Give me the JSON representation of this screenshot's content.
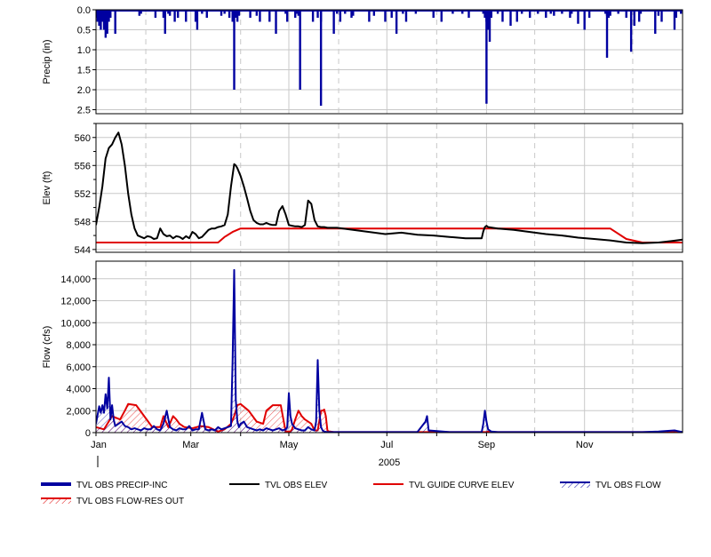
{
  "chart_data": {
    "type": "line",
    "x_axis": {
      "ticks": [
        "Jan",
        "Mar",
        "May",
        "Jul",
        "Sep",
        "Nov"
      ],
      "year_label": "2005",
      "domain_days": [
        0,
        365
      ]
    },
    "panels": [
      {
        "ylabel": "Precip (in)",
        "yticks": [
          "0.0",
          "0.5",
          "1.0",
          "1.5",
          "2.0",
          "2.5"
        ],
        "ylim": [
          2.6,
          0
        ],
        "inverted": true,
        "series": [
          {
            "name": "TVL OBS PRECIP-INC",
            "type": "bar",
            "color": "#0000a0",
            "x": [
              0,
              1,
              2,
              3,
              4,
              5,
              6,
              7,
              8,
              9,
              12,
              27,
              28,
              37,
              42,
              43,
              45,
              46,
              49,
              51,
              56,
              62,
              63,
              66,
              69,
              78,
              80,
              83,
              85,
              86,
              87,
              88,
              89,
              96,
              100,
              102,
              108,
              112,
              118,
              119,
              124,
              125,
              126,
              127,
              135,
              138,
              140,
              148,
              150,
              152,
              155,
              159,
              160,
              170,
              173,
              180,
              184,
              187,
              191,
              193,
              199,
              210,
              215,
              222,
              228,
              232,
              241,
              242,
              243,
              244,
              245,
              246,
              250,
              253,
              258,
              262,
              265,
              270,
              275,
              280,
              283,
              285,
              290,
              295,
              296,
              300,
              304,
              307,
              317,
              318,
              319,
              320,
              325,
              330,
              335,
              338,
              339,
              348,
              350,
              352,
              360,
              361,
              364
            ],
            "values": [
              0.2,
              0.3,
              0.4,
              0.5,
              0.3,
              0.5,
              0.7,
              0.6,
              0.3,
              0.2,
              0.6,
              0.15,
              0.1,
              0.2,
              0.2,
              0.6,
              0.1,
              0.15,
              0.3,
              0.2,
              0.3,
              0.3,
              0.5,
              0.1,
              0.2,
              0.15,
              0.1,
              0.2,
              0.3,
              0.15,
              0.2,
              0.3,
              0.15,
              0.2,
              0.15,
              0.3,
              0.3,
              0.6,
              0.1,
              0.3,
              0.2,
              0.1,
              0.15,
              2.0,
              0.3,
              0.2,
              0.3,
              0.6,
              0.1,
              0.3,
              0.1,
              0.2,
              0.15,
              0.3,
              0.15,
              0.3,
              0.2,
              0.6,
              0.1,
              0.3,
              0.1,
              0.2,
              0.3,
              0.1,
              0.1,
              0.2,
              0.1,
              0.2,
              0.3,
              0.5,
              0.8,
              0.2,
              0.1,
              0.3,
              0.4,
              0.3,
              0.1,
              0.2,
              0.1,
              0.2,
              0.1,
              0.15,
              0.1,
              0.2,
              0.1,
              0.35,
              0.5,
              0.2,
              0.1,
              0.15,
              0.2,
              0.15,
              0.1,
              0.2,
              0.4,
              0.3,
              0.1,
              0.6,
              0.15,
              0.3,
              0.5,
              0.2,
              0.1
            ],
            "extra_points": [
              [
                86,
                2.0
              ],
              [
                140,
                2.4
              ],
              [
                243,
                2.35
              ],
              [
                318,
                1.2
              ],
              [
                333,
                1.05
              ]
            ]
          }
        ]
      },
      {
        "ylabel": "Elev (ft)",
        "yticks": [
          "544",
          "548",
          "552",
          "556",
          "560"
        ],
        "ylim": [
          543.6,
          562
        ],
        "series": [
          {
            "name": "TVL OBS ELEV",
            "type": "line",
            "color": "#000000",
            "x": [
              0,
              2,
              4,
              6,
              8,
              10,
              12,
              14,
              16,
              18,
              20,
              22,
              24,
              26,
              28,
              30,
              32,
              34,
              36,
              38,
              40,
              42,
              44,
              46,
              48,
              50,
              52,
              54,
              56,
              58,
              60,
              62,
              64,
              66,
              68,
              70,
              72,
              74,
              76,
              78,
              80,
              82,
              84,
              86,
              87,
              88,
              90,
              92,
              94,
              96,
              98,
              100,
              102,
              104,
              106,
              108,
              110,
              112,
              114,
              116,
              118,
              120,
              122,
              124,
              126,
              128,
              130,
              132,
              134,
              136,
              138,
              140,
              142,
              144,
              146,
              148,
              150,
              160,
              170,
              180,
              190,
              200,
              210,
              220,
              230,
              240,
              241,
              242,
              243,
              244,
              250,
              260,
              270,
              280,
              290,
              300,
              310,
              320,
              330,
              340,
              350,
              358,
              365
            ],
            "values": [
              547.5,
              550,
              553,
              557,
              558.5,
              559,
              560,
              560.7,
              559,
              556,
              552,
              549,
              547,
              546,
              545.8,
              545.6,
              545.9,
              545.8,
              545.5,
              545.6,
              547,
              546.2,
              545.9,
              546,
              545.6,
              545.9,
              545.8,
              545.5,
              545.9,
              545.6,
              546.5,
              546.2,
              545.6,
              545.8,
              546.3,
              546.8,
              547,
              547,
              547.2,
              547.3,
              547.5,
              549,
              553,
              556.2,
              556,
              555.6,
              554.5,
              553,
              551.3,
              549.5,
              548.2,
              547.8,
              547.6,
              547.6,
              547.8,
              547.6,
              547.5,
              547.5,
              549.5,
              550.2,
              549,
              547.5,
              547.4,
              547.3,
              547.3,
              547.2,
              547.5,
              551,
              550.5,
              548.2,
              547.3,
              547.2,
              547.2,
              547.1,
              547.1,
              547.1,
              547.1,
              546.8,
              546.5,
              546.2,
              546.4,
              546.1,
              546,
              545.8,
              545.6,
              545.6,
              546.6,
              547.2,
              547.4,
              547.2,
              547,
              546.8,
              546.5,
              546.2,
              546,
              545.7,
              545.5,
              545.3,
              545,
              544.9,
              545,
              545.2,
              545.4
            ]
          },
          {
            "name": "TVL GUIDE CURVE ELEV",
            "type": "line",
            "color": "#e00000",
            "x": [
              0,
              76,
              80,
              85,
              90,
              110,
              130,
              150,
              170,
              250,
              290,
              310,
              320,
              330,
              340,
              365
            ],
            "values": [
              545,
              545,
              545.8,
              546.5,
              547,
              547,
              547,
              547,
              547,
              547,
              547,
              547,
              547,
              545.5,
              545,
              545
            ]
          }
        ]
      },
      {
        "ylabel": "Flow (cfs)",
        "yticks": [
          "0",
          "2,000",
          "4,000",
          "6,000",
          "8,000",
          "10,000",
          "12,000",
          "14,000"
        ],
        "ylim": [
          0,
          15600
        ],
        "series": [
          {
            "name": "TVL OBS FLOW",
            "type": "area",
            "color": "#0000a0",
            "x": [
              0,
              1,
              2,
              3,
              4,
              5,
              6,
              7,
              8,
              9,
              10,
              11,
              12,
              14,
              16,
              18,
              20,
              22,
              24,
              26,
              28,
              30,
              32,
              34,
              36,
              38,
              40,
              42,
              44,
              46,
              48,
              50,
              52,
              54,
              56,
              58,
              60,
              62,
              64,
              66,
              68,
              70,
              72,
              74,
              76,
              78,
              80,
              82,
              84,
              85,
              86,
              87,
              88,
              89,
              90,
              92,
              94,
              96,
              98,
              100,
              102,
              104,
              106,
              108,
              110,
              112,
              114,
              116,
              118,
              119,
              120,
              121,
              122,
              124,
              126,
              128,
              130,
              132,
              134,
              136,
              137,
              138,
              139,
              140,
              141,
              142,
              144,
              146,
              150,
              160,
              170,
              180,
              200,
              205,
              206,
              207,
              220,
              240,
              241,
              242,
              243,
              244,
              246,
              250,
              260,
              280,
              300,
              320,
              340,
              350,
              360,
              365
            ],
            "values": [
              800,
              1600,
              2400,
              1800,
              2500,
              1800,
              3500,
              2200,
              5000,
              1200,
              2500,
              1200,
              600,
              800,
              1000,
              600,
              500,
              300,
              400,
              300,
              200,
              400,
              300,
              300,
              600,
              300,
              200,
              800,
              2000,
              500,
              300,
              200,
              400,
              300,
              300,
              600,
              200,
              300,
              300,
              1800,
              300,
              200,
              300,
              200,
              500,
              300,
              400,
              500,
              600,
              6500,
              14800,
              3000,
              1000,
              500,
              800,
              1000,
              500,
              400,
              300,
              200,
              300,
              200,
              400,
              300,
              200,
              300,
              400,
              200,
              300,
              500,
              3600,
              1500,
              800,
              400,
              300,
              200,
              200,
              500,
              300,
              200,
              1000,
              6600,
              2000,
              500,
              200,
              100,
              50,
              50,
              50,
              50,
              50,
              50,
              50,
              1000,
              1500,
              200,
              50,
              50,
              800,
              2000,
              1000,
              300,
              100,
              50,
              50,
              50,
              50,
              50,
              50,
              100,
              200,
              50
            ]
          },
          {
            "name": "TVL OBS FLOW-RES OUT",
            "type": "area",
            "color": "#e00000",
            "x": [
              0,
              5,
              10,
              15,
              18,
              20,
              25,
              30,
              35,
              40,
              42,
              45,
              48,
              50,
              52,
              55,
              60,
              65,
              70,
              76,
              80,
              84,
              86,
              88,
              90,
              95,
              100,
              104,
              106,
              110,
              115,
              118,
              120,
              121,
              122,
              124,
              126,
              128,
              130,
              132,
              134,
              136,
              138,
              140,
              141,
              142,
              143,
              144,
              145,
              146,
              148,
              150,
              160,
              180,
              200,
              220,
              240,
              243,
              244,
              246,
              250,
              260,
              280,
              300,
              320,
              340,
              350,
              360,
              365
            ],
            "values": [
              500,
              300,
              1500,
              1200,
              2000,
              2600,
              2500,
              1500,
              500,
              500,
              1500,
              500,
              1500,
              1200,
              800,
              500,
              400,
              600,
              500,
              100,
              300,
              800,
              1500,
              2500,
              2600,
              2000,
              1000,
              800,
              2000,
              2500,
              2500,
              100,
              100,
              100,
              300,
              1200,
              2000,
              1500,
              1200,
              1000,
              800,
              200,
              200,
              2000,
              2000,
              2100,
              1500,
              200,
              100,
              100,
              50,
              50,
              50,
              50,
              50,
              50,
              50,
              50,
              100,
              50,
              50,
              50,
              50,
              50,
              50,
              50,
              50,
              50,
              50
            ]
          }
        ]
      }
    ],
    "legend": [
      {
        "label": "TVL OBS PRECIP-INC",
        "style": "thick",
        "color": "#0000a0"
      },
      {
        "label": "TVL OBS ELEV",
        "style": "line",
        "color": "#000000"
      },
      {
        "label": "TVL GUIDE CURVE ELEV",
        "style": "line",
        "color": "#e00000"
      },
      {
        "label": "TVL OBS FLOW",
        "style": "hatch",
        "color": "#0000a0"
      },
      {
        "label": "TVL OBS FLOW-RES OUT",
        "style": "hatch",
        "color": "#e00000"
      }
    ],
    "legend_position": "bottom",
    "grid": true
  }
}
